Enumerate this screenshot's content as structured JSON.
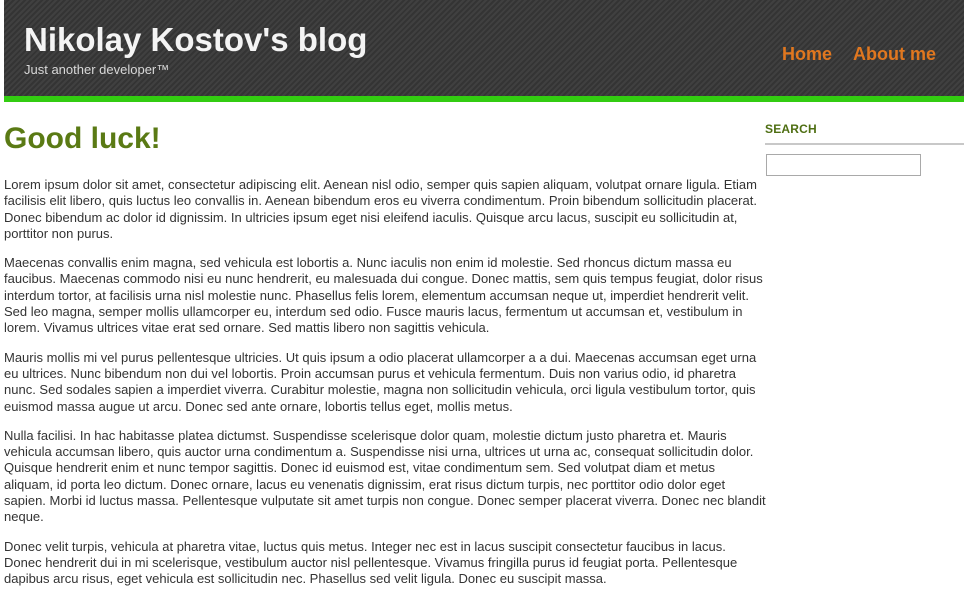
{
  "header": {
    "title": "Nikolay Kostov's blog",
    "tagline": "Just another developer™",
    "nav": [
      {
        "label": "Home"
      },
      {
        "label": "About me"
      }
    ]
  },
  "post": {
    "title": "Good luck!",
    "paragraphs": [
      "Lorem ipsum dolor sit amet, consectetur adipiscing elit. Aenean nisl odio, semper quis sapien aliquam, volutpat ornare ligula. Etiam facilisis elit libero, quis luctus leo convallis in. Aenean bibendum eros eu viverra condimentum. Proin bibendum sollicitudin placerat. Donec bibendum ac dolor id dignissim. In ultricies ipsum eget nisi eleifend iaculis. Quisque arcu lacus, suscipit eu sollicitudin at, porttitor non purus.",
      "Maecenas convallis enim magna, sed vehicula est lobortis a. Nunc iaculis non enim id molestie. Sed rhoncus dictum massa eu faucibus. Maecenas commodo nisi eu nunc hendrerit, eu malesuada dui congue. Donec mattis, sem quis tempus feugiat, dolor risus interdum tortor, at facilisis urna nisl molestie nunc. Phasellus felis lorem, elementum accumsan neque ut, imperdiet hendrerit velit. Sed leo magna, semper mollis ullamcorper eu, interdum sed odio. Fusce mauris lacus, fermentum ut accumsan et, vestibulum in lorem. Vivamus ultrices vitae erat sed ornare. Sed mattis libero non sagittis vehicula.",
      "Mauris mollis mi vel purus pellentesque ultricies. Ut quis ipsum a odio placerat ullamcorper a a dui. Maecenas accumsan eget urna eu ultrices. Nunc bibendum non dui vel lobortis. Proin accumsan purus et vehicula fermentum. Duis non varius odio, id pharetra nunc. Sed sodales sapien a imperdiet viverra. Curabitur molestie, magna non sollicitudin vehicula, orci ligula vestibulum tortor, quis euismod massa augue ut arcu. Donec sed ante ornare, lobortis tellus eget, mollis metus.",
      "Nulla facilisi. In hac habitasse platea dictumst. Suspendisse scelerisque dolor quam, molestie dictum justo pharetra et. Mauris vehicula accumsan libero, quis auctor urna condimentum a. Suspendisse nisi urna, ultrices ut urna ac, consequat sollicitudin dolor. Quisque hendrerit enim et nunc tempor sagittis. Donec id euismod est, vitae condimentum sem. Sed volutpat diam et metus aliquam, id porta leo dictum. Donec ornare, lacus eu venenatis dignissim, erat risus dictum turpis, nec porttitor odio dolor eget sapien. Morbi id luctus massa. Pellentesque vulputate sit amet turpis non congue. Donec semper placerat viverra. Donec nec blandit neque.",
      "Donec velit turpis, vehicula at pharetra vitae, luctus quis metus. Integer nec est in lacus suscipit consectetur faucibus in lacus. Donec hendrerit dui in mi scelerisque, vestibulum auctor nisl pellentesque. Vivamus fringilla purus id feugiat porta. Pellentesque dapibus arcu risus, eget vehicula est sollicitudin nec. Phasellus sed velit ligula. Donec eu suscipit massa."
    ]
  },
  "sidebar": {
    "search": {
      "title": "SEARCH",
      "value": ""
    }
  },
  "colors": {
    "header_background": "#3a3a3a",
    "accent_bar": "#33cc11",
    "nav_link": "#e0771f",
    "post_title": "#5a7a14",
    "widget_title": "#4e6e12"
  }
}
